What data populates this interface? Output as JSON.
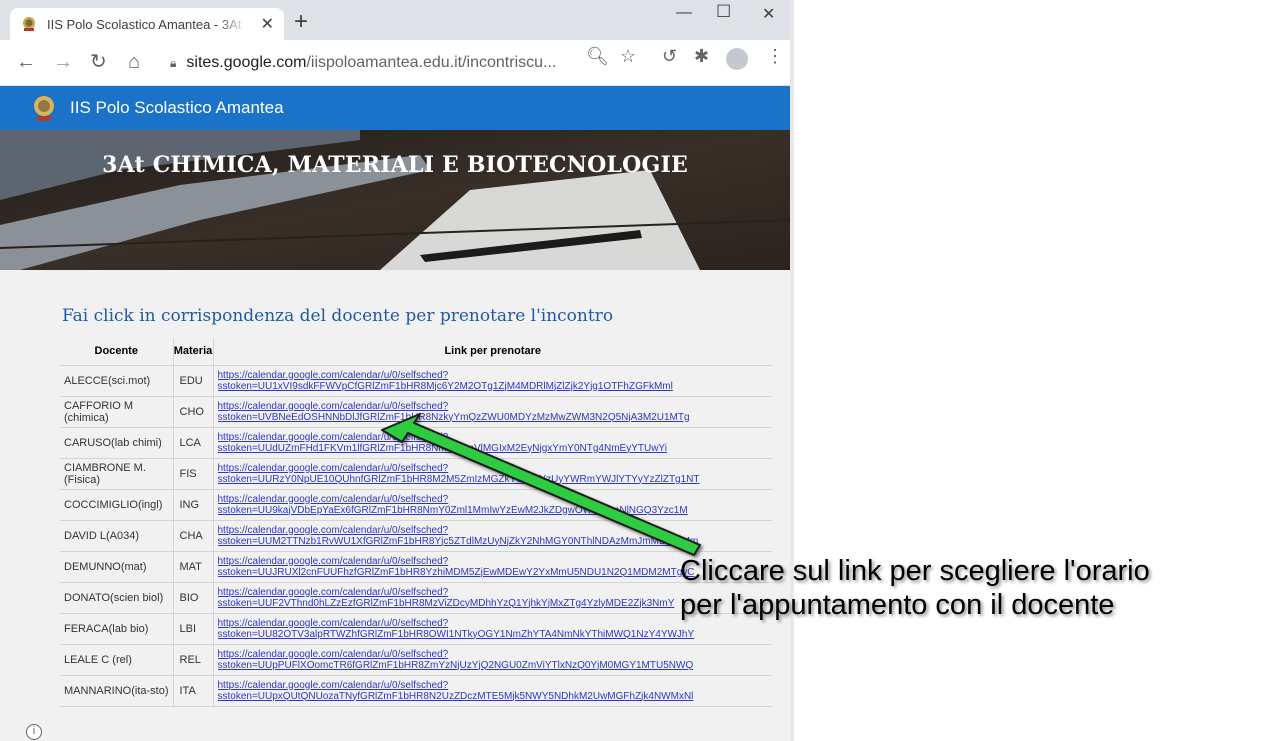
{
  "browser": {
    "tab_title": "IIS Polo Scolastico Amantea - 3At",
    "url_host": "sites.google.com",
    "url_path": "/iispoloamantea.edu.it/incontriscu...",
    "icons": [
      "back-icon",
      "forward-icon",
      "reload-icon",
      "home-icon",
      "lock-icon",
      "zoom-icon",
      "star-icon",
      "history-icon",
      "extensions-icon",
      "profile-icon",
      "menu-icon"
    ]
  },
  "site": {
    "title": "IIS Polo Scolastico Amantea",
    "banner_title": "3At CHIMICA, MATERIALI E BIOTECNOLOGIE",
    "instruction": "Fai click in corrispondenza del docente per prenotare l'incontro",
    "accent_color": "#1a73c8"
  },
  "table": {
    "headers": [
      "Docente",
      "Materia",
      "Link per prenotare"
    ],
    "rows": [
      {
        "docente": "ALECCE(sci.mot)",
        "materia": "EDU",
        "link1": "https://calendar.google.com/calendar/u/0/selfsched?",
        "link2": "sstoken=UU1xVI9sdkFFWVpCfGRlZmF1bHR8Mjc6Y2M2OTg1ZjM4MDRlMjZlZjk2Yjg1OTFhZGFkMml"
      },
      {
        "docente": "CAFFORIO M (chimica)",
        "materia": "CHO",
        "link1": "https://calendar.google.com/calendar/u/0/selfsched?",
        "link2": "sstoken=UVBNeEdOSHNNbDlJfGRlZmF1bHR8NzkyYmQzZWU0MDYzMzMwZWM3N2Q5NjA3M2U1MTg"
      },
      {
        "docente": "CARUSO(lab chimi)",
        "materia": "LCA",
        "link1": "https://calendar.google.com/calendar/u/0/selfsched?",
        "link2": "sstoken=UUdUZmFHd1FKVm1lfGRlZmF1bHR8NmE1YmVlMGIxM2EyNjgxYmY0NTg4NmEyYTUwYi"
      },
      {
        "docente": "CIAMBRONE M. (Fisica)",
        "materia": "FIS",
        "link1": "https://calendar.google.com/calendar/u/0/selfsched?",
        "link2": "sstoken=UURzY0NpUE10QUhnfGRlZmF1bHR8M2M5ZmIzMGZkYWM2YzUyYWRmYWJlYTYyYzZlZTg1NT"
      },
      {
        "docente": "COCCIMIGLIO(ingl)",
        "materia": "ING",
        "link1": "https://calendar.google.com/calendar/u/0/selfsched?",
        "link2": "sstoken=UU9kajVDbEpYaEx6fGRlZmF1bHR8NmY0Zml1MmIwYzEwM2JkZDgwOWE3YmNlNGQ3Yzc1M"
      },
      {
        "docente": "DAVID L(A034)",
        "materia": "CHA",
        "link1": "https://calendar.google.com/calendar/u/0/selfsched?",
        "link2": "sstoken=UUM2TTNzb1RvWU1XfGRlZmF1bHR8Yjc5ZTdlMzUyNjZkY2NhMGY0NThlNDAzMmJmMDNmMm"
      },
      {
        "docente": "DEMUNNO(mat)",
        "materia": "MAT",
        "link1": "https://calendar.google.com/calendar/u/0/selfsched?",
        "link2": "sstoken=UUJRUXl2cnFUUFhzfGRlZmF1bHR8YzhiMDM5ZjEwMDEwY2YxMmU5NDU1N2Q1MDM2MTgyC"
      },
      {
        "docente": "DONATO(scien biol)",
        "materia": "BIO",
        "link1": "https://calendar.google.com/calendar/u/0/selfsched?",
        "link2": "sstoken=UUF2VThnd0hLZzEzfGRlZmF1bHR8MzViZDcyMDhhYzQ1YjhkYjMxZTg4YzlyMDE2Zjk3NmY"
      },
      {
        "docente": "FERACA(lab bio)",
        "materia": "LBI",
        "link1": "https://calendar.google.com/calendar/u/0/selfsched?",
        "link2": "sstoken=UU82OTV3alpRTWZhfGRlZmF1bHR8OWI1NTkyOGY1NmZhYTA4NmNkYThiMWQ1NzY4YWJhY"
      },
      {
        "docente": "LEALE C (rel)",
        "materia": "REL",
        "link1": "https://calendar.google.com/calendar/u/0/selfsched?",
        "link2": "sstoken=UUpPUFlXOomcTR6fGRlZmF1bHR8ZmYzNjUzYjQ2NGU0ZmViYTlxNzQ0YjM0MGY1MTU5NWQ"
      },
      {
        "docente": "MANNARINO(ita-sto)",
        "materia": "ITA",
        "link1": "https://calendar.google.com/calendar/u/0/selfsched?",
        "link2": "sstoken=UUpxQUtQNUozaTNyfGRlZmF1bHR8N2UzZDczMTE5Mjk5NWY5NDhkM2UwMGFhZjk4NWMxNl"
      }
    ]
  },
  "callout": {
    "line1": "Cliccare sul link per scegliere l'orario",
    "line2": "per l'appuntamento con il docente",
    "arrow_color": "#2ecc40"
  }
}
